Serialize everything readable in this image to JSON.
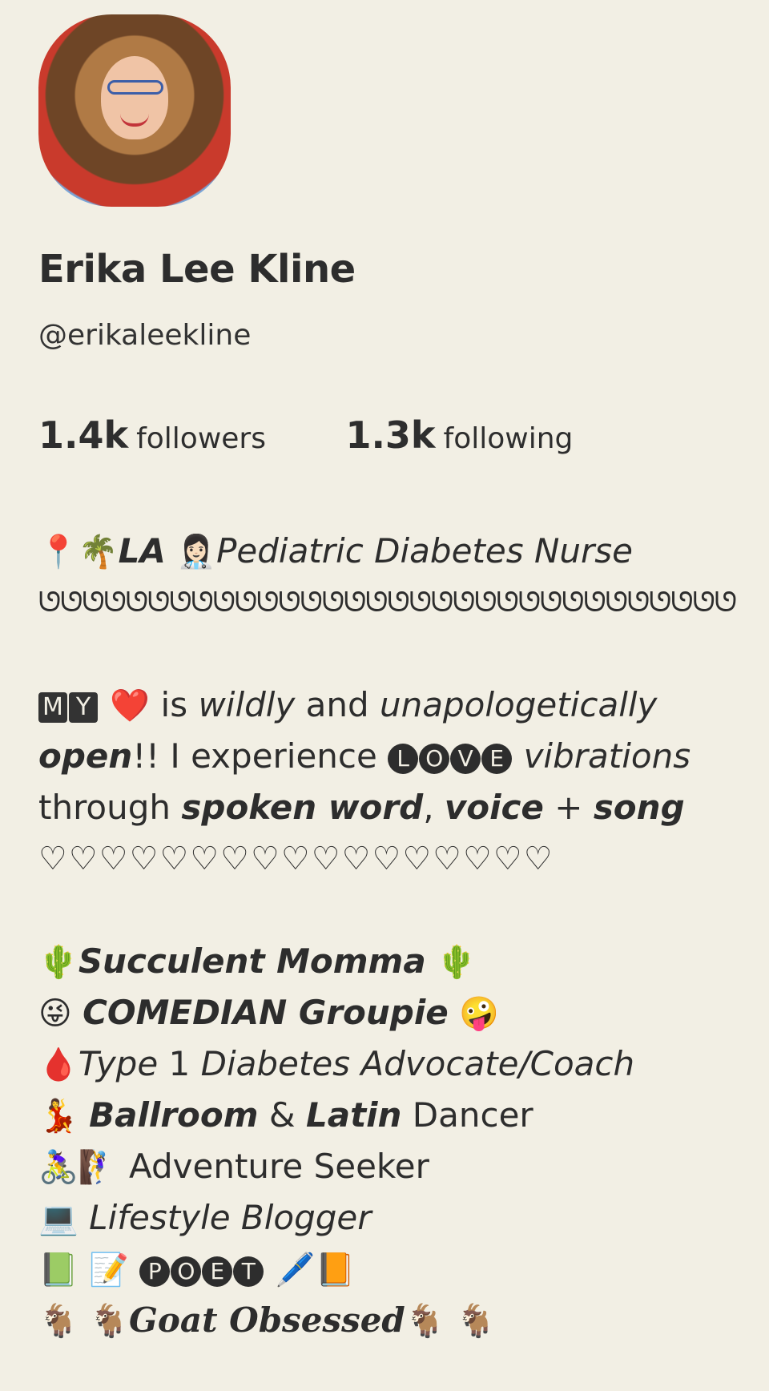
{
  "profile": {
    "name": "Erika Lee Kline",
    "handle": "@erikaleekline"
  },
  "stats": {
    "followers_count": "1.4k",
    "followers_label": "followers",
    "following_count": "1.3k",
    "following_label": "following"
  },
  "bio": {
    "line1": {
      "pin": "📍",
      "palm": "🌴",
      "location": "LA",
      "nurse": "👩🏻‍⚕️",
      "title": "Pediatric Diabetes Nurse"
    },
    "pattern": "ᘎᘎᘎᘎᘎᘎᘎᘎᘎᘎᘎᘎᘎᘎᘎᘎᘎᘎᘎᘎᘎᘎᘎᘎᘎᘎᘎᘎᘎᘎᘎᘎ",
    "line3": {
      "m": "M",
      "y": "Y",
      "heart": "❤️",
      "is": " is ",
      "wildly": "wildly",
      "and": " and ",
      "unapologetically": "unapologetically"
    },
    "line4": {
      "open": "open",
      "excl": "!! I experience ",
      "l": "L",
      "o": "O",
      "v": "V",
      "e": "E",
      "vibrations": " vibrations"
    },
    "line5": {
      "through": "through ",
      "spoken": "spoken word",
      "comma": ", ",
      "voice": "voice",
      "plus": " + ",
      "song": "song"
    },
    "hearts": "♡♡♡♡♡♡♡♡♡♡♡♡♡♡♡♡♡",
    "succulent": {
      "cactus": "🌵",
      "text": "Succulent Momma"
    },
    "comedian": {
      "left": "😜",
      "text": "COMEDIAN Groupie",
      "right": "🤪"
    },
    "diabetes": {
      "drop": "🩸",
      "type": "Type",
      "one": " 1 ",
      "rest": "Diabetes Advocate/Coach"
    },
    "dancer": {
      "emoji": "💃",
      "ballroom": "Ballroom",
      "amp": " & ",
      "latin": "Latin",
      "dancer": " Dancer"
    },
    "adventure": {
      "bike": "🚴‍♀️",
      "climb": "🧗‍♀️",
      "text": "Adventure Seeker"
    },
    "blogger": {
      "laptop": "💻",
      "text": "Lifestyle Blogger"
    },
    "poet": {
      "book1": "📗",
      "memo": "📝",
      "p": "P",
      "o": "O",
      "e": "E",
      "t": "T",
      "pen": "🖊️",
      "book2": "📙"
    },
    "goat": {
      "goat": "🐐",
      "text": "Goat Obsessed"
    }
  }
}
